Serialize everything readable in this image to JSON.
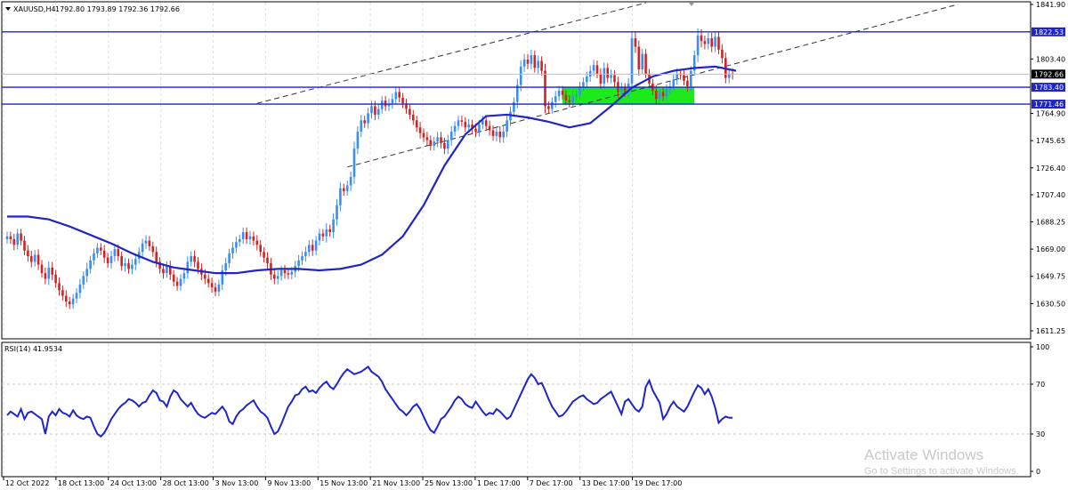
{
  "header": {
    "symbol": "XAUUSD,H4",
    "ohlc": "1792.80 1793.89 1792.36 1792.66",
    "rsi_label": "RSI(14) 41.9534"
  },
  "colors": {
    "bull_candle": "#3a8ef0",
    "bear_candle": "#d42222",
    "moving_average": "#1f25c8",
    "hline": "#1f25c8",
    "channel": "#333333",
    "zone": "#1dea1d",
    "rsi": "#1f25c8",
    "grid": "#e0e0e0"
  },
  "watermark": {
    "title": "Activate Windows",
    "subtitle": "Go to Settings to activate Windows."
  },
  "chart_data": [
    {
      "type": "candlestick",
      "title": "XAUUSD,H4",
      "ylim": [
        1600,
        1842
      ],
      "price_ticks": [
        "1841.90",
        "1822.53",
        "1803.40",
        "1792.66",
        "1783.40",
        "1771.46",
        "1764.90",
        "1745.65",
        "1726.40",
        "1707.40",
        "1688.25",
        "1669.00",
        "1649.75",
        "1630.50",
        "1611.25"
      ],
      "price_ticks_plain": [
        "1841.90",
        "1803.40",
        "1764.90",
        "1745.65",
        "1726.40",
        "1707.40",
        "1688.25",
        "1669.00",
        "1649.75",
        "1630.50",
        "1611.25"
      ],
      "x_ticks": [
        "12 Oct 2022",
        "18 Oct 13:00",
        "24 Oct 13:00",
        "28 Oct 13:00",
        "3 Nov 13:00",
        "9 Nov 13:00",
        "15 Nov 13:00",
        "21 Nov 13:00",
        "25 Nov 13:00",
        "1 Dec 17:00",
        "7 Dec 17:00",
        "13 Dec 17:00",
        "19 Dec 17:00"
      ],
      "horizontal_levels": [
        {
          "value": 1822.53,
          "label": "1822.53"
        },
        {
          "value": 1783.4,
          "label": "1783.40"
        },
        {
          "value": 1771.46,
          "label": "1771.46"
        }
      ],
      "current_price": {
        "value": 1792.66,
        "label": "1792.66"
      },
      "zone": {
        "bar_start": 160,
        "bar_end": 198,
        "low": 1771.46,
        "high": 1783.4
      },
      "channel": {
        "upper": {
          "from": [
            72,
            1772
          ],
          "to": [
            184,
            1843
          ]
        },
        "lower": {
          "from": [
            98,
            1727
          ],
          "to": [
            274,
            1842
          ]
        }
      },
      "moving_average": [
        1692,
        1692,
        1690,
        1685,
        1679,
        1673,
        1666,
        1660,
        1656,
        1654,
        1652,
        1652,
        1654,
        1655,
        1655,
        1654,
        1655,
        1658,
        1665,
        1678,
        1700,
        1728,
        1750,
        1763,
        1764,
        1762,
        1759,
        1755,
        1758,
        1770,
        1783,
        1791,
        1795,
        1797,
        1798,
        1795
      ],
      "ma_bar_step": 6,
      "closes": [
        1678,
        1676,
        1672,
        1680,
        1675,
        1668,
        1664,
        1660,
        1665,
        1658,
        1652,
        1648,
        1656,
        1651,
        1645,
        1640,
        1636,
        1632,
        1630,
        1634,
        1638,
        1644,
        1650,
        1655,
        1661,
        1666,
        1670,
        1668,
        1663,
        1659,
        1664,
        1669,
        1664,
        1657,
        1659,
        1655,
        1658,
        1662,
        1667,
        1673,
        1675,
        1671,
        1667,
        1660,
        1655,
        1652,
        1657,
        1651,
        1646,
        1643,
        1648,
        1652,
        1660,
        1664,
        1660,
        1655,
        1651,
        1648,
        1645,
        1642,
        1639,
        1644,
        1654,
        1659,
        1666,
        1670,
        1674,
        1676,
        1681,
        1676,
        1678,
        1675,
        1672,
        1667,
        1663,
        1659,
        1651,
        1648,
        1650,
        1654,
        1652,
        1651,
        1653,
        1657,
        1661,
        1664,
        1667,
        1672,
        1668,
        1675,
        1680,
        1678,
        1683,
        1681,
        1690,
        1700,
        1712,
        1710,
        1714,
        1720,
        1740,
        1752,
        1760,
        1758,
        1765,
        1770,
        1764,
        1768,
        1774,
        1770,
        1772,
        1775,
        1780,
        1776,
        1772,
        1768,
        1764,
        1760,
        1755,
        1751,
        1748,
        1746,
        1742,
        1745,
        1748,
        1744,
        1740,
        1746,
        1752,
        1756,
        1760,
        1759,
        1755,
        1757,
        1754,
        1752,
        1757,
        1760,
        1756,
        1753,
        1749,
        1752,
        1748,
        1752,
        1760,
        1766,
        1773,
        1785,
        1798,
        1803,
        1800,
        1806,
        1797,
        1802,
        1795,
        1770,
        1768,
        1773,
        1777,
        1781,
        1778,
        1774,
        1773,
        1777,
        1778,
        1784,
        1787,
        1791,
        1795,
        1799,
        1793,
        1786,
        1797,
        1790,
        1792,
        1787,
        1780,
        1783,
        1780,
        1786,
        1818,
        1812,
        1796,
        1807,
        1793,
        1786,
        1781,
        1775,
        1780,
        1777,
        1782,
        1784,
        1789,
        1793,
        1792,
        1788,
        1784,
        1795,
        1806,
        1820,
        1816,
        1814,
        1818,
        1812,
        1819,
        1810,
        1804,
        1790,
        1793,
        1792.66
      ],
      "ranges": [
        6,
        6,
        7,
        6,
        6,
        6,
        7,
        7,
        6,
        7,
        6,
        7,
        8,
        7,
        6,
        7,
        6,
        7,
        6,
        6,
        6,
        7,
        6,
        8,
        6,
        6,
        6,
        6,
        7,
        6,
        7,
        7,
        6,
        6,
        7,
        6,
        7,
        7,
        6,
        6,
        7,
        6,
        6,
        7,
        6,
        7,
        6,
        7,
        6,
        6,
        6,
        6,
        7,
        6,
        7,
        6,
        7,
        7,
        6,
        7,
        6,
        6,
        7,
        7,
        6,
        7,
        7,
        6,
        6,
        6,
        7,
        6,
        7,
        6,
        6,
        7,
        7,
        7,
        7,
        6,
        7,
        6,
        6,
        7,
        7,
        6,
        7,
        6,
        7,
        6,
        6,
        6,
        8,
        6,
        8,
        8,
        8,
        6,
        6,
        7,
        9,
        7,
        7,
        6,
        7,
        7,
        7,
        6,
        6,
        6,
        6,
        7,
        7,
        6,
        6,
        6,
        6,
        6,
        6,
        7,
        6,
        7,
        6,
        6,
        7,
        7,
        7,
        7,
        7,
        6,
        6,
        6,
        6,
        7,
        6,
        7,
        6,
        6,
        6,
        7,
        6,
        7,
        7,
        7,
        7,
        7,
        6,
        8,
        8,
        7,
        7,
        7,
        6,
        7,
        6,
        9,
        6,
        6,
        7,
        6,
        6,
        6,
        7,
        7,
        6,
        6,
        6,
        6,
        7,
        7,
        6,
        7,
        7,
        6,
        7,
        6,
        7,
        7,
        6,
        7,
        9,
        8,
        8,
        6,
        6,
        6,
        6,
        7,
        7,
        6,
        6,
        6,
        6,
        7,
        6,
        6,
        7,
        6,
        6,
        9,
        8,
        7,
        7,
        7,
        7,
        6,
        7,
        7,
        7,
        7,
        6
      ]
    },
    {
      "type": "line",
      "title": "RSI(14) 41.9534",
      "ylim": [
        0,
        100
      ],
      "y_ticks": [
        "100",
        "70",
        "30",
        "0"
      ],
      "levels": [
        70,
        30
      ],
      "series": [
        {
          "name": "RSI(14)",
          "values": [
            45,
            48,
            46,
            44,
            50,
            42,
            47,
            48,
            46,
            44,
            42,
            30,
            44,
            48,
            45,
            50,
            47,
            46,
            44,
            49,
            45,
            43,
            42,
            44,
            43,
            36,
            30,
            28,
            31,
            36,
            42,
            46,
            50,
            53,
            55,
            58,
            57,
            55,
            52,
            55,
            56,
            61,
            65,
            63,
            57,
            56,
            52,
            60,
            65,
            63,
            58,
            55,
            52,
            55,
            50,
            46,
            44,
            43,
            45,
            47,
            46,
            49,
            52,
            48,
            40,
            38,
            44,
            48,
            50,
            53,
            55,
            57,
            52,
            48,
            46,
            43,
            36,
            30,
            32,
            38,
            45,
            52,
            56,
            61,
            62,
            66,
            68,
            64,
            65,
            63,
            67,
            70,
            72,
            68,
            66,
            70,
            75,
            79,
            82,
            80,
            78,
            79,
            80,
            82,
            84,
            80,
            78,
            76,
            72,
            66,
            62,
            58,
            54,
            50,
            48,
            45,
            48,
            52,
            54,
            50,
            44,
            38,
            33,
            31,
            36,
            42,
            44,
            48,
            52,
            57,
            60,
            58,
            54,
            52,
            51,
            56,
            52,
            48,
            45,
            47,
            46,
            50,
            48,
            45,
            42,
            44,
            50,
            56,
            62,
            68,
            74,
            78,
            75,
            70,
            71,
            65,
            58,
            52,
            48,
            44,
            45,
            48,
            52,
            56,
            58,
            60,
            61,
            58,
            56,
            54,
            55,
            58,
            60,
            62,
            64,
            58,
            52,
            46,
            56,
            58,
            54,
            50,
            48,
            52,
            68,
            73,
            65,
            60,
            55,
            42,
            46,
            52,
            56,
            52,
            50,
            48,
            52,
            58,
            64,
            69,
            67,
            62,
            66,
            60,
            51,
            39,
            42,
            44,
            43,
            43
          ],
          "bar_start": 0
        }
      ]
    }
  ]
}
